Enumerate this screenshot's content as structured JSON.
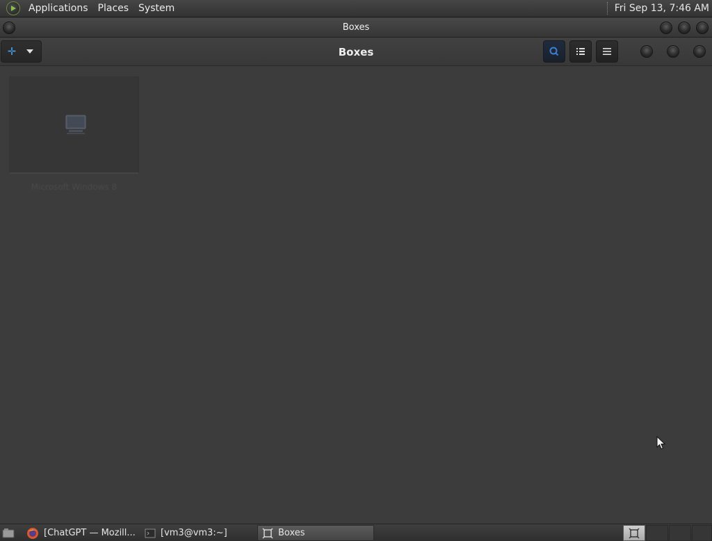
{
  "top_panel": {
    "menus": [
      "Applications",
      "Places",
      "System"
    ],
    "clock": "Fri Sep 13,  7:46 AM"
  },
  "window": {
    "title": "Boxes"
  },
  "headerbar": {
    "title": "Boxes",
    "new_button_icon": "plus-icon",
    "buttons": [
      "search-icon",
      "list-view-icon",
      "menu-icon"
    ]
  },
  "boxes": [
    {
      "name": "Microsoft Windows 8",
      "icon": "computer-icon"
    }
  ],
  "taskbar": {
    "tasks": [
      {
        "label": "[ChatGPT — Mozill...",
        "icon": "firefox-icon"
      },
      {
        "label": "[vm3@vm3:~]",
        "icon": "terminal-icon"
      },
      {
        "label": "Boxes",
        "icon": "boxes-icon"
      }
    ]
  },
  "colors": {
    "background": "#3c3c3c",
    "accent_blue": "#4aa0e8"
  }
}
